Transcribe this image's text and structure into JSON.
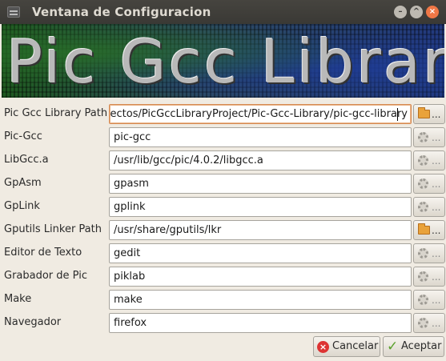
{
  "window": {
    "title": "Ventana de Configuracion"
  },
  "banner": {
    "text": "Pic Gcc Library"
  },
  "fields": [
    {
      "label": "Pic Gcc Library Path",
      "value": "ectos/PicGccLibraryProject/Pic-Gcc-Library/pic-gcc-library",
      "browse": "folder",
      "browse_label": "..."
    },
    {
      "label": "Pic-Gcc",
      "value": "pic-gcc",
      "browse": "gear",
      "browse_label": "..."
    },
    {
      "label": "LibGcc.a",
      "value": "/usr/lib/gcc/pic/4.0.2/libgcc.a",
      "browse": "gear",
      "browse_label": "..."
    },
    {
      "label": "GpAsm",
      "value": "gpasm",
      "browse": "gear",
      "browse_label": "..."
    },
    {
      "label": "GpLink",
      "value": "gplink",
      "browse": "gear",
      "browse_label": "..."
    },
    {
      "label": "Gputils Linker Path",
      "value": "/usr/share/gputils/lkr",
      "browse": "folder",
      "browse_label": "..."
    },
    {
      "label": "Editor de Texto",
      "value": "gedit",
      "browse": "gear",
      "browse_label": "..."
    },
    {
      "label": "Grabador de Pic",
      "value": "piklab",
      "browse": "gear",
      "browse_label": "..."
    },
    {
      "label": "Make",
      "value": "make",
      "browse": "gear",
      "browse_label": "..."
    },
    {
      "label": "Navegador",
      "value": "firefox",
      "browse": "gear",
      "browse_label": "..."
    }
  ],
  "buttons": {
    "cancel": "Cancelar",
    "accept": "Aceptar"
  }
}
